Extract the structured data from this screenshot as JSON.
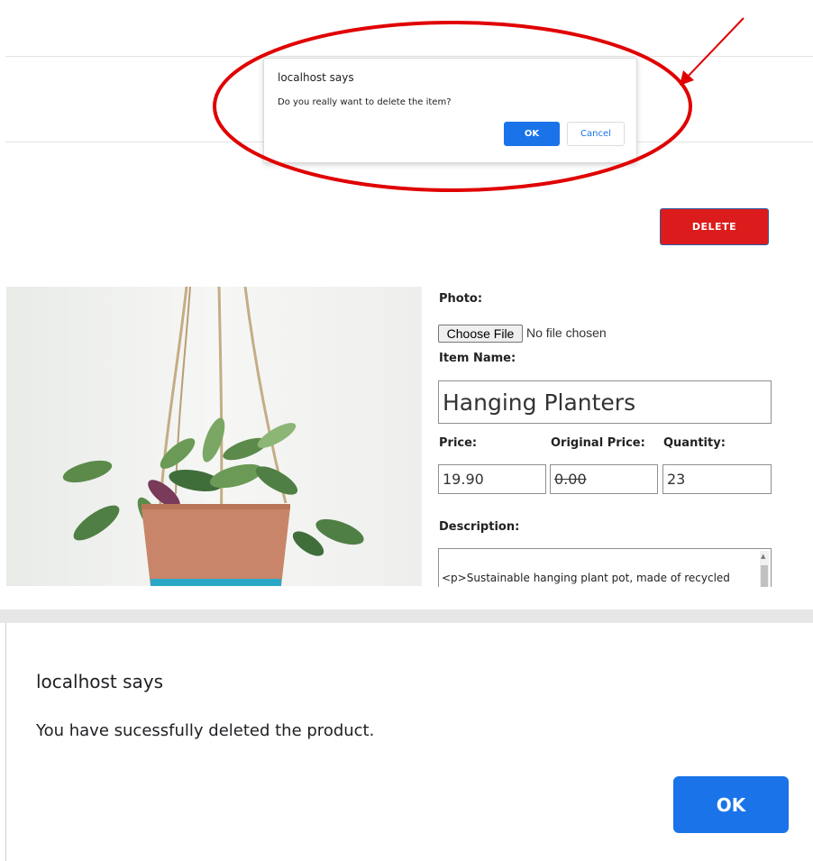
{
  "confirm_dialog": {
    "origin": "localhost says",
    "message": "Do you really want to delete the item?",
    "ok_label": "OK",
    "cancel_label": "Cancel"
  },
  "actions": {
    "delete_label": "DELETE"
  },
  "form": {
    "photo_label": "Photo:",
    "choose_file_label": "Choose File",
    "file_status": "No file chosen",
    "item_name_label": "Item Name:",
    "item_name_value": "Hanging Planters",
    "price_label": "Price:",
    "price_value": "19.90",
    "original_price_label": "Original Price:",
    "original_price_value": "0.00",
    "quantity_label": "Quantity:",
    "quantity_value": "23",
    "description_label": "Description:",
    "description_value": "<p>Sustainable hanging plant pot, made of recycled"
  },
  "alert_dialog": {
    "origin": "localhost says",
    "message": "You have sucessfully deleted the product.",
    "ok_label": "OK"
  },
  "colors": {
    "primary_blue": "#1a73e8",
    "delete_red": "#dc1c1c",
    "annotation_red": "#e00000",
    "pot_terracotta": "#c98569"
  },
  "icons": {
    "scrollbar_up": "triangle-up-icon"
  }
}
